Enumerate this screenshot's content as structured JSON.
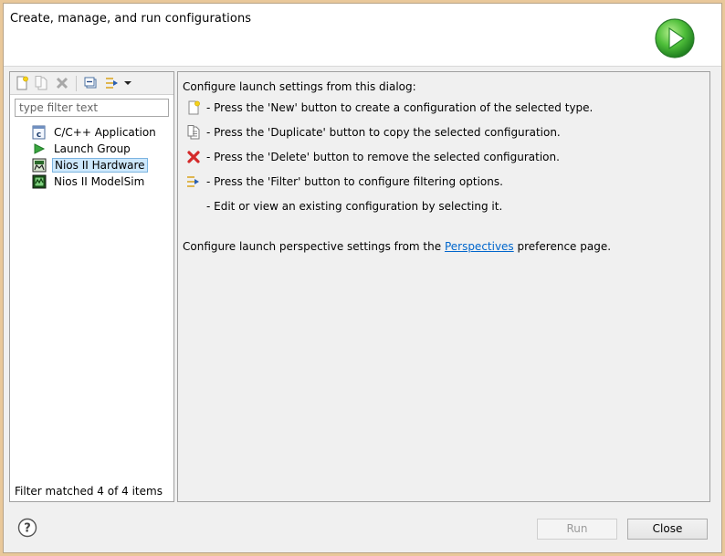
{
  "banner": {
    "title": "Create, manage, and run configurations",
    "icon": "run-icon"
  },
  "toolbar": {
    "buttons": [
      "new-configuration-icon",
      "duplicate-icon",
      "delete-icon",
      "collapse-all-icon",
      "filter-icon",
      "dropdown-arrow-icon"
    ]
  },
  "filter": {
    "placeholder": "type filter text",
    "value": ""
  },
  "tree": {
    "items": [
      {
        "label": "C/C++ Application",
        "icon": "c-application-icon",
        "selected": false
      },
      {
        "label": "Launch Group",
        "icon": "launch-group-icon",
        "selected": false
      },
      {
        "label": "Nios II Hardware",
        "icon": "nios-hardware-icon",
        "selected": true
      },
      {
        "label": "Nios II ModelSim",
        "icon": "nios-modelsim-icon",
        "selected": false
      }
    ]
  },
  "filter_status": "Filter matched 4 of 4 items",
  "main": {
    "heading": "Configure launch settings from this dialog:",
    "instructions": [
      {
        "icon": "new-configuration-icon",
        "text": "- Press the 'New' button to create a configuration of the selected type."
      },
      {
        "icon": "duplicate-icon",
        "text": "- Press the 'Duplicate' button to copy the selected configuration."
      },
      {
        "icon": "delete-icon",
        "text": "- Press the 'Delete' button to remove the selected configuration."
      },
      {
        "icon": "filter-icon",
        "text": "- Press the 'Filter' button to configure filtering options."
      },
      {
        "icon": "",
        "text": "- Edit or view an existing configuration by selecting it."
      }
    ],
    "perspective_prefix": "Configure launch perspective settings from the ",
    "perspective_link": "Perspectives",
    "perspective_suffix": " preference page."
  },
  "buttons": {
    "run": "Run",
    "close": "Close"
  },
  "colors": {
    "selection": "#cde8fc",
    "link": "#0066cc",
    "run_icon": "#3aa640"
  }
}
